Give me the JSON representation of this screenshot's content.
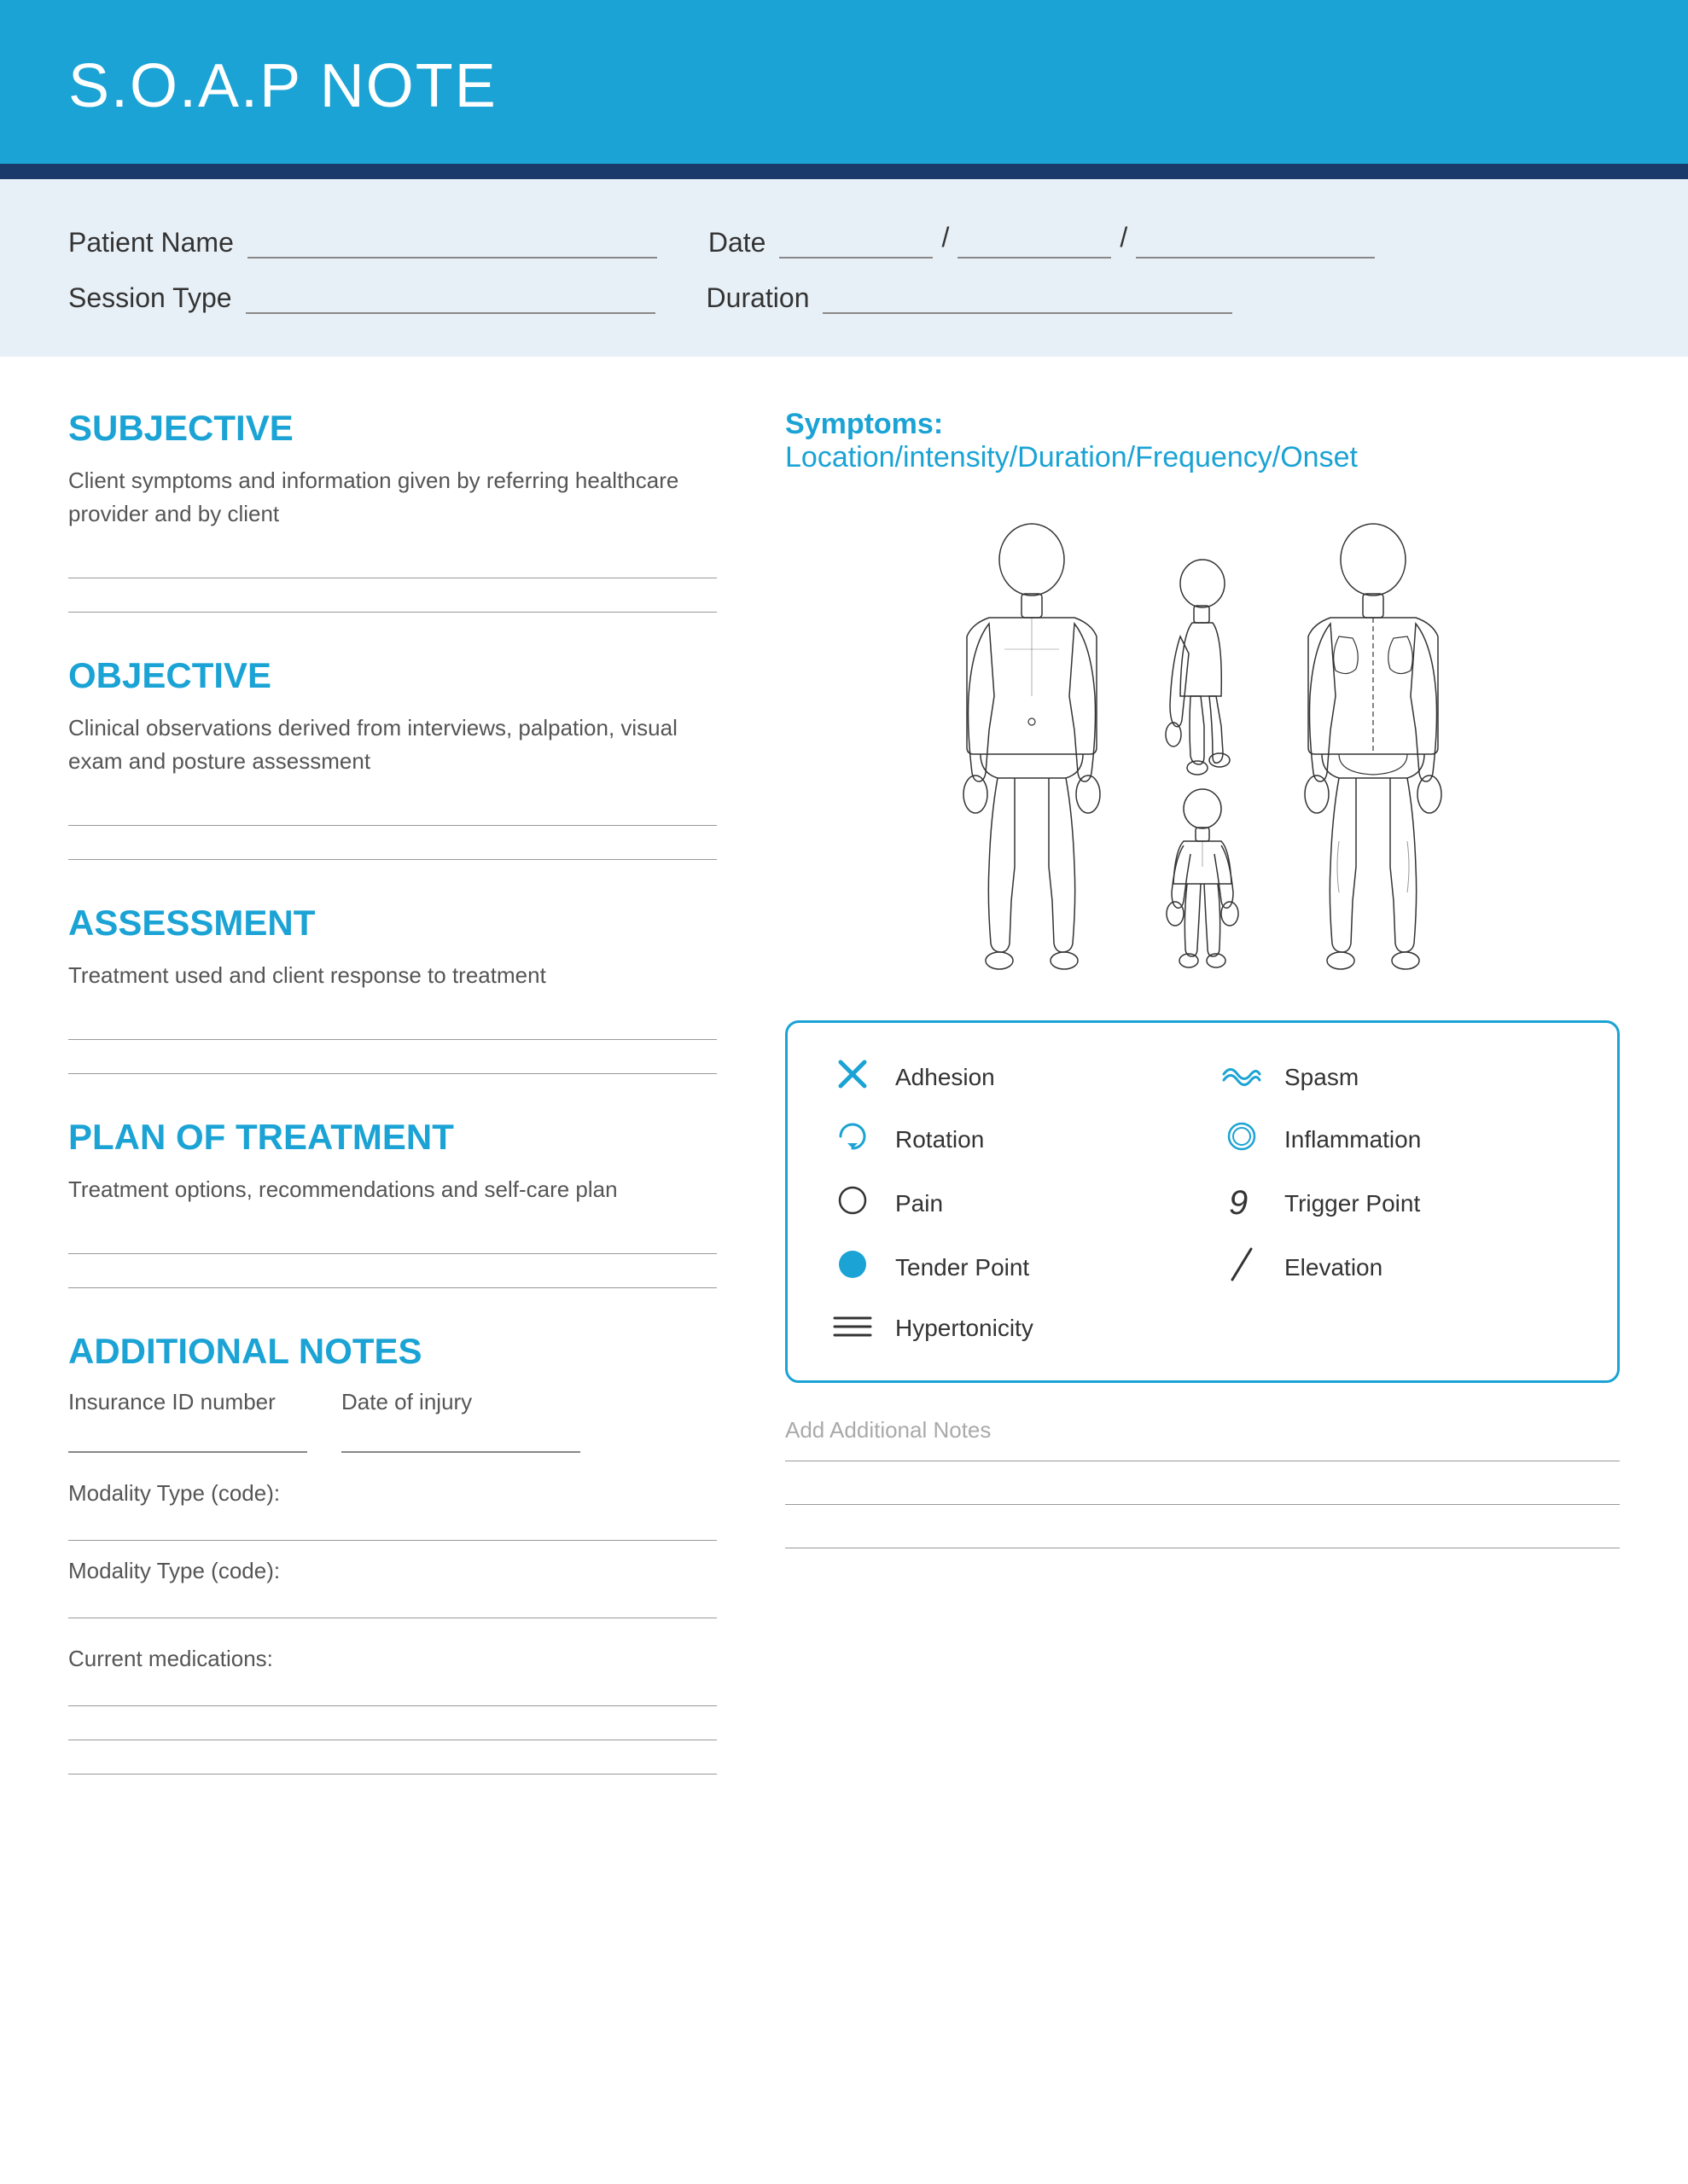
{
  "header": {
    "title": "S.O.A.P NOTE"
  },
  "patient_info": {
    "patient_name_label": "Patient Name",
    "date_label": "Date",
    "session_type_label": "Session Type",
    "duration_label": "Duration"
  },
  "subjective": {
    "title": "SUBJECTIVE",
    "description": "Client symptoms and information given by referring healthcare provider and by client"
  },
  "objective": {
    "title": "OBJECTIVE",
    "description": "Clinical observations derived from interviews, palpation, visual exam and posture assessment"
  },
  "assessment": {
    "title": "ASSESSMENT",
    "description": "Treatment used and client response to treatment"
  },
  "plan": {
    "title": "PLAN OF TREATMENT",
    "description": "Treatment options, recommendations and self-care plan"
  },
  "additional_notes": {
    "title": "ADDITIONAL NOTES",
    "insurance_label": "Insurance ID number",
    "date_of_injury_label": "Date of injury",
    "modality1_label": "Modality Type (code):",
    "modality2_label": "Modality Type (code):",
    "medications_label": "Current medications:"
  },
  "symptoms": {
    "title": "Symptoms:",
    "subtitle": "Location/intensity/Duration/Frequency/Onset"
  },
  "legend": {
    "items": [
      {
        "icon": "✕",
        "label": "Adhesion",
        "icon_type": "x"
      },
      {
        "icon": "≈",
        "label": "Spasm",
        "icon_type": "wave"
      },
      {
        "icon": "↻",
        "label": "Rotation",
        "icon_type": "rotate"
      },
      {
        "icon": "○",
        "label": "Inflammation",
        "icon_type": "circle-outline"
      },
      {
        "icon": "○",
        "label": "Pain",
        "icon_type": "circle-thin"
      },
      {
        "icon": "9",
        "label": "Trigger Point",
        "icon_type": "nine"
      },
      {
        "icon": "●",
        "label": "Tender Point",
        "icon_type": "circle-filled"
      },
      {
        "icon": "/",
        "label": "Elevation",
        "icon_type": "slash"
      },
      {
        "icon": "≡",
        "label": "Hypertonicity",
        "icon_type": "lines"
      }
    ]
  },
  "add_notes_right": {
    "label": "Add Additional Notes"
  }
}
